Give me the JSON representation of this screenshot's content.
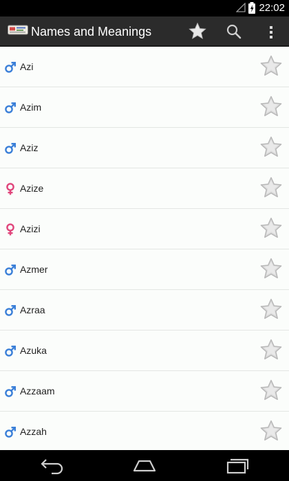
{
  "status_bar": {
    "time": "22:02"
  },
  "app": {
    "title": "Names and Meanings"
  },
  "colors": {
    "male": "#3a7fd8",
    "female": "#e0457b",
    "action_bar": "#2b2b2b",
    "list_bg": "#fbfdfb"
  },
  "action_bar_icons": [
    "star-icon",
    "search-icon",
    "overflow-menu-icon"
  ],
  "names": [
    {
      "name": "Azi",
      "gender": "male"
    },
    {
      "name": "Azim",
      "gender": "male"
    },
    {
      "name": "Aziz",
      "gender": "male"
    },
    {
      "name": "Azize",
      "gender": "female"
    },
    {
      "name": "Azizi",
      "gender": "female"
    },
    {
      "name": "Azmer",
      "gender": "male"
    },
    {
      "name": "Azraa",
      "gender": "male"
    },
    {
      "name": "Azuka",
      "gender": "male"
    },
    {
      "name": "Azzaam",
      "gender": "male"
    },
    {
      "name": "Azzah",
      "gender": "male"
    }
  ]
}
